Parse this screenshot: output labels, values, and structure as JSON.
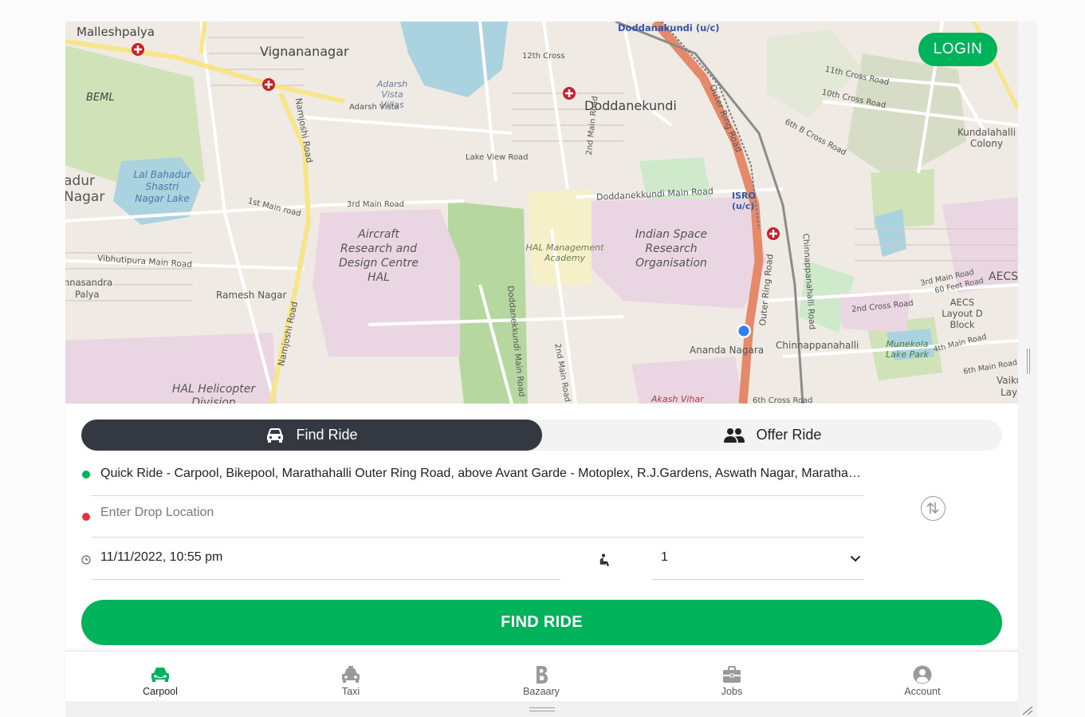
{
  "map": {
    "login_label": "LOGIN",
    "labels": {
      "malleshpalya": "Malleshpalya",
      "vignananagar": "Vignananagar",
      "beml": "BEML",
      "doddanakundi_uc": "Doddanakundi (u/c)",
      "doddanekundi": "Doddanekundi",
      "twelfth_cross": "12th Cross",
      "eleventh_cross": "11th Cross Road",
      "tenth_cross": "10th Cross Road",
      "kundalahalli": "Kundalahalli Colony",
      "sixth_b_cross": "6th B Cross Road",
      "lake_view": "Lake View Road",
      "adarsh_vista": "Adarsh Vista Villas",
      "adarsh_vista2": "Adarsh Vista",
      "lal_bahadur": "Lal Bahadur Shastri Nagar Lake",
      "adur": "adur",
      "nagar": "Nagar",
      "first_main": "1st Main road",
      "third_main": "3rd Main Road",
      "aircraft": "Aircraft Research and Design Centre HAL",
      "hal_academy": "HAL Management Academy",
      "isro_org": "Indian Space Research Organisation",
      "isro_uc": "ISRO (u/c)",
      "dodd_main": "Doddanekkundi Main Road",
      "outer_ring": "Outer Ring Road",
      "vibhutipura": "Vibhutipura Main Road",
      "nnasandra": "nnasandra",
      "palya": "Palya",
      "ramesh_nagar": "Ramesh Nagar",
      "namjoshi": "Namjoshi Road",
      "hal_heli": "HAL Helicopter Division",
      "ananda_nagara": "Ananda Nagara",
      "chinnappanahalli": "Chinnappanahalli",
      "chinnappanahalli_road": "Chinnappanahalli Road",
      "akash_vihar": "Akash Vihar",
      "sixth_cross": "6th Cross Road",
      "aecs_layout": "AECS Layout D Block",
      "aecs": "AECS L",
      "sixty_feet": "60 Feet Road",
      "third_main_road": "3rd Main Road",
      "second_cross": "2nd Cross Road",
      "munekola": "Munekola Lake Park",
      "fourth_main": "4th Main Road",
      "sixth_main": "6th Main Road",
      "second_main": "2nd Main Road",
      "vaiku": "Vaiku",
      "lay": "Lay",
      "second_main_road2": "2nd Main Road"
    }
  },
  "tabs": {
    "find_ride": "Find Ride",
    "offer_ride": "Offer Ride"
  },
  "form": {
    "pickup_value": "Quick Ride - Carpool, Bikepool, Marathahalli Outer Ring Road, above Avant Garde - Motoplex, R.J.Gardens, Aswath Nagar, Marathahalli,...",
    "drop_placeholder": "Enter Drop Location",
    "datetime": "11/11/2022, 10:55 pm",
    "seats": "1",
    "find_button": "FIND RIDE"
  },
  "nav": {
    "items": [
      {
        "label": "Carpool",
        "icon": "carpool-icon",
        "active": true
      },
      {
        "label": "Taxi",
        "icon": "taxi-icon",
        "active": false
      },
      {
        "label": "Bazaary",
        "icon": "bazaary-icon",
        "active": false
      },
      {
        "label": "Jobs",
        "icon": "jobs-icon",
        "active": false
      },
      {
        "label": "Account",
        "icon": "account-icon",
        "active": false
      }
    ]
  },
  "colors": {
    "accent": "#00b25a",
    "tab_active": "#343840",
    "pickup_dot": "#00b25a",
    "drop_dot": "#e0343f",
    "location_marker": "#2f7ff5"
  }
}
